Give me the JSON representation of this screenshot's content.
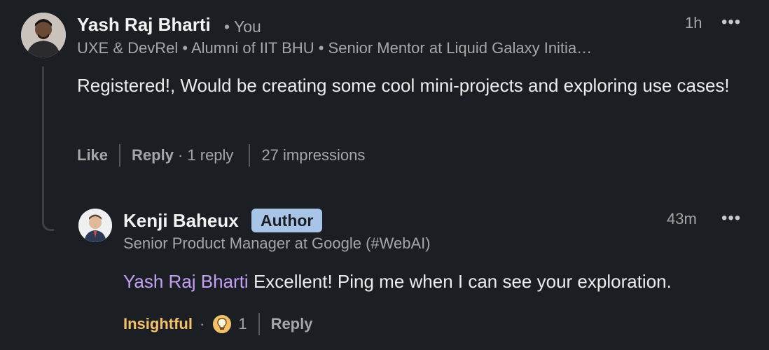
{
  "main_comment": {
    "author": "Yash Raj Bharti",
    "you_label": "• You",
    "headline": "UXE & DevRel • Alumni of IIT BHU • Senior Mentor at Liquid Galaxy Initia…",
    "time": "1h",
    "text": "Registered!, Would be creating some cool mini-projects and exploring use cases!",
    "like_label": "Like",
    "reply_label": "Reply",
    "reply_count": "· 1 reply",
    "impressions": "27 impressions"
  },
  "reply_comment": {
    "author": "Kenji Baheux",
    "badge": "Author",
    "headline": "Senior Product Manager at Google (#WebAI)",
    "time": "43m",
    "mention": "Yash Raj Bharti",
    "text": "Excellent! Ping me when I can see your exploration.",
    "reaction_label": "Insightful",
    "reaction_dot": "·",
    "reaction_count": "1",
    "reply_label": "Reply"
  },
  "more_glyph": "•••",
  "colors": {
    "background": "#1b1f23",
    "author_badge": "#a8c5e8",
    "mention": "#c4a0f5",
    "insightful": "#f5c06a"
  },
  "icons": [
    "more-options-icon",
    "insightful-reaction-icon"
  ]
}
